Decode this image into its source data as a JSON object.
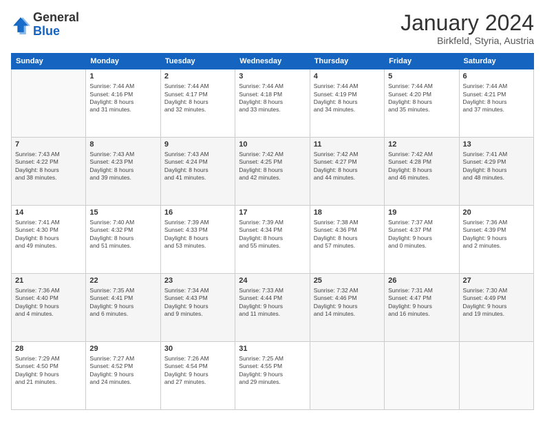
{
  "header": {
    "logo_general": "General",
    "logo_blue": "Blue",
    "title": "January 2024",
    "location": "Birkfeld, Styria, Austria"
  },
  "weekdays": [
    "Sunday",
    "Monday",
    "Tuesday",
    "Wednesday",
    "Thursday",
    "Friday",
    "Saturday"
  ],
  "weeks": [
    [
      {
        "day": "",
        "info": ""
      },
      {
        "day": "1",
        "info": "Sunrise: 7:44 AM\nSunset: 4:16 PM\nDaylight: 8 hours\nand 31 minutes."
      },
      {
        "day": "2",
        "info": "Sunrise: 7:44 AM\nSunset: 4:17 PM\nDaylight: 8 hours\nand 32 minutes."
      },
      {
        "day": "3",
        "info": "Sunrise: 7:44 AM\nSunset: 4:18 PM\nDaylight: 8 hours\nand 33 minutes."
      },
      {
        "day": "4",
        "info": "Sunrise: 7:44 AM\nSunset: 4:19 PM\nDaylight: 8 hours\nand 34 minutes."
      },
      {
        "day": "5",
        "info": "Sunrise: 7:44 AM\nSunset: 4:20 PM\nDaylight: 8 hours\nand 35 minutes."
      },
      {
        "day": "6",
        "info": "Sunrise: 7:44 AM\nSunset: 4:21 PM\nDaylight: 8 hours\nand 37 minutes."
      }
    ],
    [
      {
        "day": "7",
        "info": "Sunrise: 7:43 AM\nSunset: 4:22 PM\nDaylight: 8 hours\nand 38 minutes."
      },
      {
        "day": "8",
        "info": "Sunrise: 7:43 AM\nSunset: 4:23 PM\nDaylight: 8 hours\nand 39 minutes."
      },
      {
        "day": "9",
        "info": "Sunrise: 7:43 AM\nSunset: 4:24 PM\nDaylight: 8 hours\nand 41 minutes."
      },
      {
        "day": "10",
        "info": "Sunrise: 7:42 AM\nSunset: 4:25 PM\nDaylight: 8 hours\nand 42 minutes."
      },
      {
        "day": "11",
        "info": "Sunrise: 7:42 AM\nSunset: 4:27 PM\nDaylight: 8 hours\nand 44 minutes."
      },
      {
        "day": "12",
        "info": "Sunrise: 7:42 AM\nSunset: 4:28 PM\nDaylight: 8 hours\nand 46 minutes."
      },
      {
        "day": "13",
        "info": "Sunrise: 7:41 AM\nSunset: 4:29 PM\nDaylight: 8 hours\nand 48 minutes."
      }
    ],
    [
      {
        "day": "14",
        "info": "Sunrise: 7:41 AM\nSunset: 4:30 PM\nDaylight: 8 hours\nand 49 minutes."
      },
      {
        "day": "15",
        "info": "Sunrise: 7:40 AM\nSunset: 4:32 PM\nDaylight: 8 hours\nand 51 minutes."
      },
      {
        "day": "16",
        "info": "Sunrise: 7:39 AM\nSunset: 4:33 PM\nDaylight: 8 hours\nand 53 minutes."
      },
      {
        "day": "17",
        "info": "Sunrise: 7:39 AM\nSunset: 4:34 PM\nDaylight: 8 hours\nand 55 minutes."
      },
      {
        "day": "18",
        "info": "Sunrise: 7:38 AM\nSunset: 4:36 PM\nDaylight: 8 hours\nand 57 minutes."
      },
      {
        "day": "19",
        "info": "Sunrise: 7:37 AM\nSunset: 4:37 PM\nDaylight: 9 hours\nand 0 minutes."
      },
      {
        "day": "20",
        "info": "Sunrise: 7:36 AM\nSunset: 4:39 PM\nDaylight: 9 hours\nand 2 minutes."
      }
    ],
    [
      {
        "day": "21",
        "info": "Sunrise: 7:36 AM\nSunset: 4:40 PM\nDaylight: 9 hours\nand 4 minutes."
      },
      {
        "day": "22",
        "info": "Sunrise: 7:35 AM\nSunset: 4:41 PM\nDaylight: 9 hours\nand 6 minutes."
      },
      {
        "day": "23",
        "info": "Sunrise: 7:34 AM\nSunset: 4:43 PM\nDaylight: 9 hours\nand 9 minutes."
      },
      {
        "day": "24",
        "info": "Sunrise: 7:33 AM\nSunset: 4:44 PM\nDaylight: 9 hours\nand 11 minutes."
      },
      {
        "day": "25",
        "info": "Sunrise: 7:32 AM\nSunset: 4:46 PM\nDaylight: 9 hours\nand 14 minutes."
      },
      {
        "day": "26",
        "info": "Sunrise: 7:31 AM\nSunset: 4:47 PM\nDaylight: 9 hours\nand 16 minutes."
      },
      {
        "day": "27",
        "info": "Sunrise: 7:30 AM\nSunset: 4:49 PM\nDaylight: 9 hours\nand 19 minutes."
      }
    ],
    [
      {
        "day": "28",
        "info": "Sunrise: 7:29 AM\nSunset: 4:50 PM\nDaylight: 9 hours\nand 21 minutes."
      },
      {
        "day": "29",
        "info": "Sunrise: 7:27 AM\nSunset: 4:52 PM\nDaylight: 9 hours\nand 24 minutes."
      },
      {
        "day": "30",
        "info": "Sunrise: 7:26 AM\nSunset: 4:54 PM\nDaylight: 9 hours\nand 27 minutes."
      },
      {
        "day": "31",
        "info": "Sunrise: 7:25 AM\nSunset: 4:55 PM\nDaylight: 9 hours\nand 29 minutes."
      },
      {
        "day": "",
        "info": ""
      },
      {
        "day": "",
        "info": ""
      },
      {
        "day": "",
        "info": ""
      }
    ]
  ]
}
